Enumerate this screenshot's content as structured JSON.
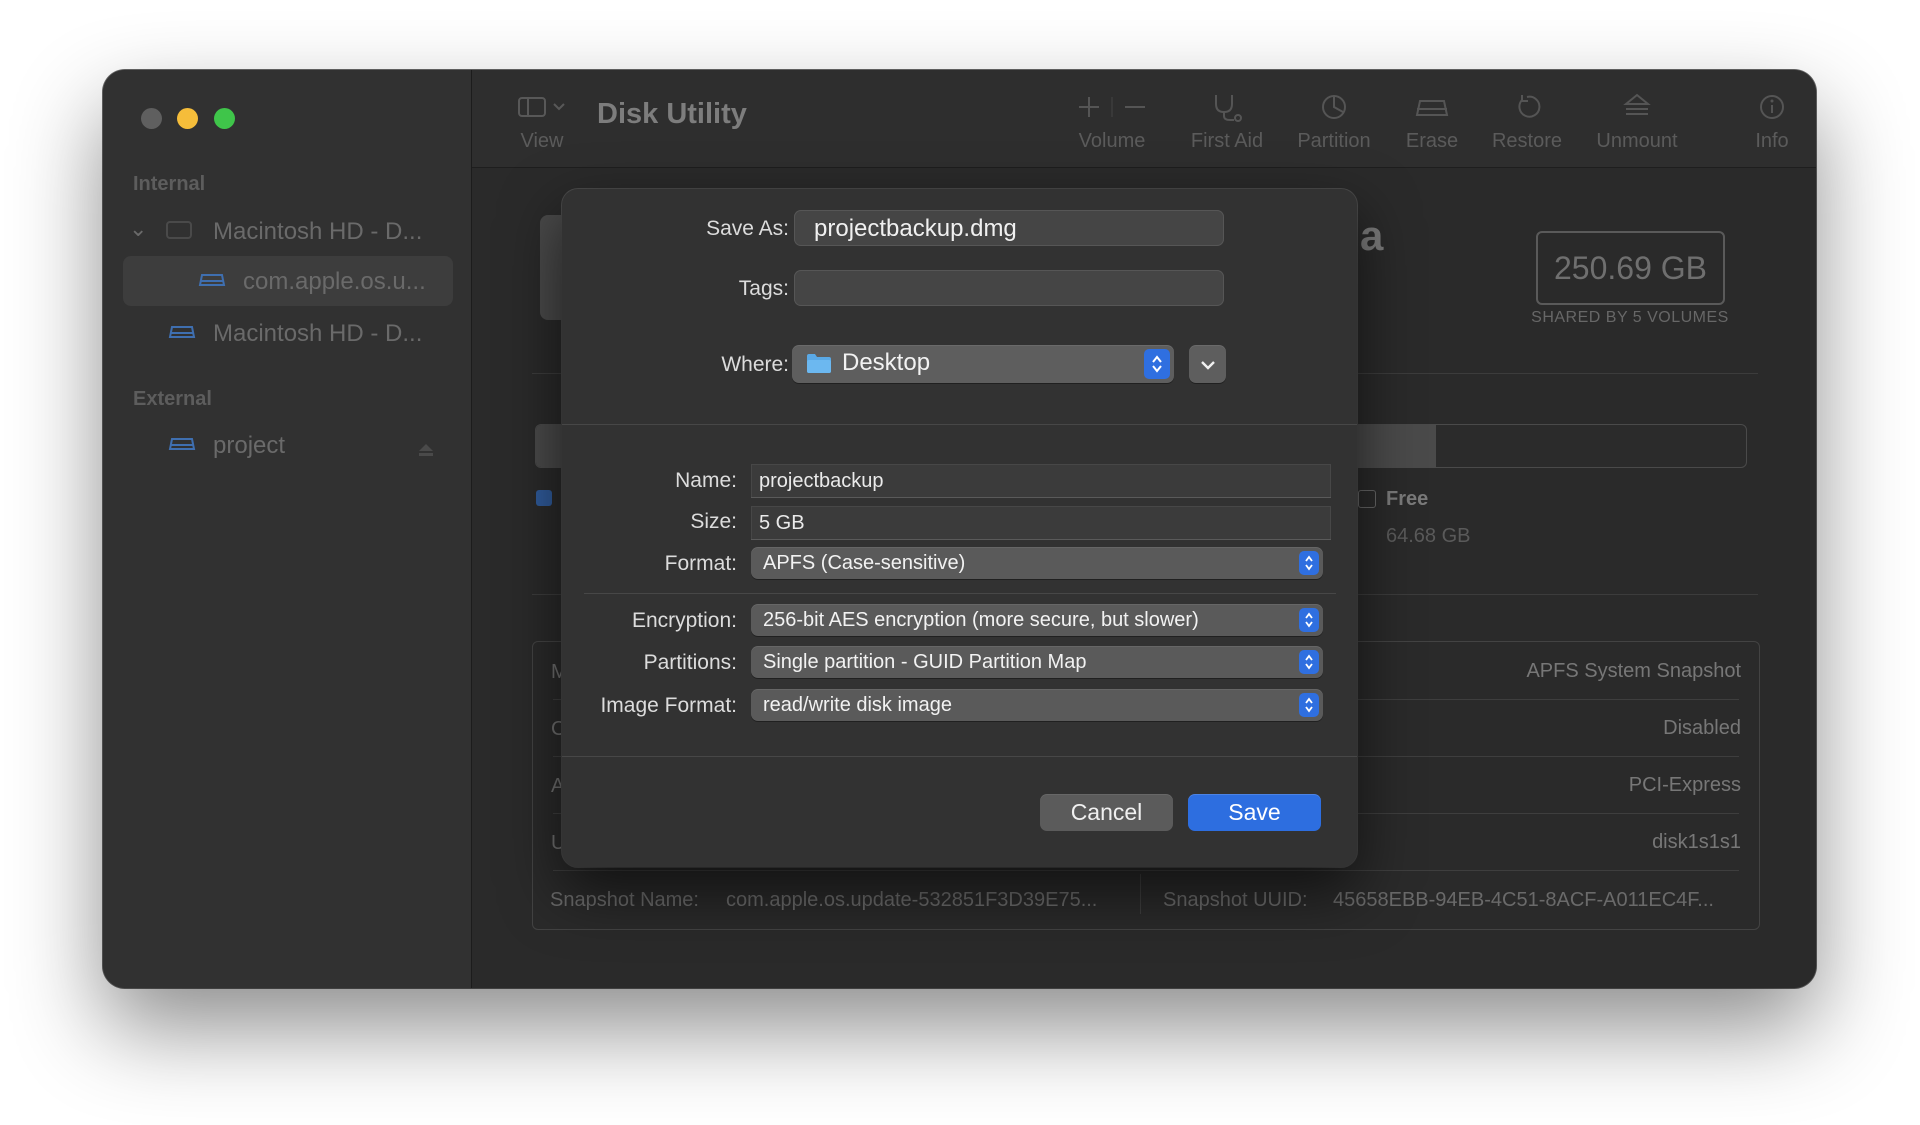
{
  "app": {
    "title": "Disk Utility"
  },
  "sidebar": {
    "sections": [
      {
        "label": "Internal"
      },
      {
        "label": "External"
      }
    ],
    "items": [
      {
        "label": "Macintosh HD - D..."
      },
      {
        "label": "com.apple.os.u..."
      },
      {
        "label": "Macintosh HD - D..."
      },
      {
        "label": "project"
      }
    ]
  },
  "toolbar": {
    "view": "View",
    "volume": "Volume",
    "first_aid": "First Aid",
    "partition": "Partition",
    "erase": "Erase",
    "restore": "Restore",
    "unmount": "Unmount",
    "info": "Info"
  },
  "background": {
    "title_fragment": "a",
    "capacity": "250.69 GB",
    "shared": "SHARED BY 5 VOLUMES",
    "free_label": "Free",
    "free_value": "64.68 GB",
    "info_rows_right": [
      "APFS System Snapshot",
      "Disabled",
      "PCI-Express",
      "disk1s1s1"
    ],
    "info_rows_left_initials": [
      "M",
      "C",
      "A",
      "U"
    ],
    "snapshot_name_label": "Snapshot Name:",
    "snapshot_name_value": "com.apple.os.update-532851F3D39E75...",
    "snapshot_uuid_label": "Snapshot UUID:",
    "snapshot_uuid_value": "45658EBB-94EB-4C51-8ACF-A011EC4F..."
  },
  "dialog": {
    "save_as_label": "Save As:",
    "save_as_value": "projectbackup.dmg",
    "tags_label": "Tags:",
    "tags_value": "",
    "where_label": "Where:",
    "where_value": "Desktop",
    "name_label": "Name:",
    "name_value": "projectbackup",
    "size_label": "Size:",
    "size_value": "5 GB",
    "format_label": "Format:",
    "format_value": "APFS (Case-sensitive)",
    "encryption_label": "Encryption:",
    "encryption_value": "256-bit AES encryption (more secure, but slower)",
    "partitions_label": "Partitions:",
    "partitions_value": "Single partition - GUID Partition Map",
    "image_format_label": "Image Format:",
    "image_format_value": "read/write disk image",
    "cancel": "Cancel",
    "save": "Save"
  },
  "colors": {
    "accent": "#2d6ee0",
    "close": "#5f5f5f",
    "minimize": "#f5bd3a",
    "maximize": "#3fc54a",
    "folder": "#5aa9e6"
  }
}
